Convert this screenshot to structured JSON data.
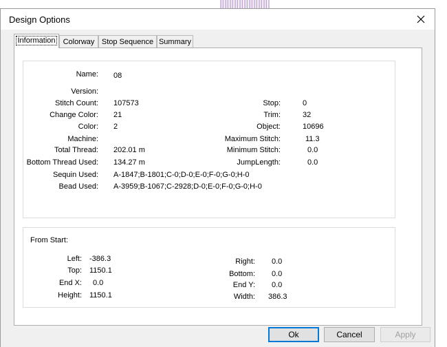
{
  "dialog": {
    "title": "Design Options",
    "tabs": [
      {
        "label": "Information",
        "active": true
      },
      {
        "label": "Colorway",
        "active": false
      },
      {
        "label": "Stop Sequence",
        "active": false
      },
      {
        "label": "Summary",
        "active": false
      }
    ]
  },
  "info": {
    "name_label": "Name:",
    "name_value": "08",
    "version_label": "Version:",
    "version_value": "",
    "stitch_count_label": "Stitch Count:",
    "stitch_count_value": "107573",
    "change_color_label": "Change Color:",
    "change_color_value": "21",
    "color_label": "Color:",
    "color_value": "2",
    "machine_label": "Machine:",
    "machine_value": "",
    "total_thread_label": "Total Thread:",
    "total_thread_value": "202.01 m",
    "bottom_thread_label": "Bottom Thread Used:",
    "bottom_thread_value": "134.27 m",
    "sequin_label": "Sequin Used:",
    "sequin_value": "A-1847;B-1801;C-0;D-0;E-0;F-0;G-0;H-0",
    "bead_label": "Bead Used:",
    "bead_value": "A-3959;B-1067;C-2928;D-0;E-0;F-0;G-0;H-0",
    "stop_label": "Stop:",
    "stop_value": "0",
    "trim_label": "Trim:",
    "trim_value": "32",
    "object_label": "Object:",
    "object_value": "10696",
    "max_stitch_label": "Maximum Stitch:",
    "max_stitch_value": "11.3",
    "min_stitch_label": "Minimum Stitch:",
    "min_stitch_value": "0.0",
    "jump_length_label": "JumpLength:",
    "jump_length_value": "0.0"
  },
  "from_start": {
    "heading": "From Start:",
    "left_label": "Left:",
    "left_value": "-386.3",
    "top_label": "Top:",
    "top_value": "1150.1",
    "end_x_label": "End X:",
    "end_x_value": "0.0",
    "height_label": "Height:",
    "height_value": "1150.1",
    "right_label": "Right:",
    "right_value": "0.0",
    "bottom_label": "Bottom:",
    "bottom_value": "0.0",
    "end_y_label": "End Y:",
    "end_y_value": "0.0",
    "width_label": "Width:",
    "width_value": "386.3"
  },
  "buttons": {
    "ok": "Ok",
    "cancel": "Cancel",
    "apply": "Apply"
  },
  "icons": {
    "close": "close-icon"
  },
  "colors": {
    "accent": "#0078d7"
  }
}
